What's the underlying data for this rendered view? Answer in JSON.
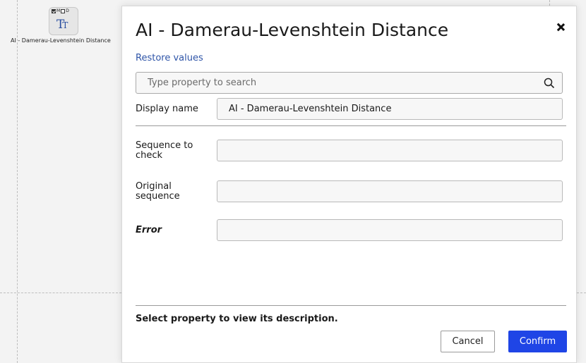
{
  "canvas": {
    "node": {
      "flag_m": "M",
      "flag_d": "D",
      "glyph_big": "T",
      "glyph_small": "T",
      "label": "AI - Damerau-Levenshtein Distance"
    }
  },
  "dialog": {
    "title": "AI - Damerau-Levenshtein Distance",
    "restore_label": "Restore values",
    "search": {
      "placeholder": "Type property to search",
      "value": ""
    },
    "display_name": {
      "label": "Display name",
      "value": "AI - Damerau-Levenshtein Distance"
    },
    "properties": [
      {
        "label": "Sequence to check",
        "value": ""
      },
      {
        "label": "Original sequence",
        "value": ""
      },
      {
        "label": "Error",
        "value": ""
      }
    ],
    "description": "Select property to view its description.",
    "cancel_label": "Cancel",
    "confirm_label": "Confirm",
    "colors": {
      "accent": "#1f45e6",
      "link": "#2f55a8"
    },
    "icons": {
      "close": "close-icon",
      "search": "search-icon"
    }
  }
}
